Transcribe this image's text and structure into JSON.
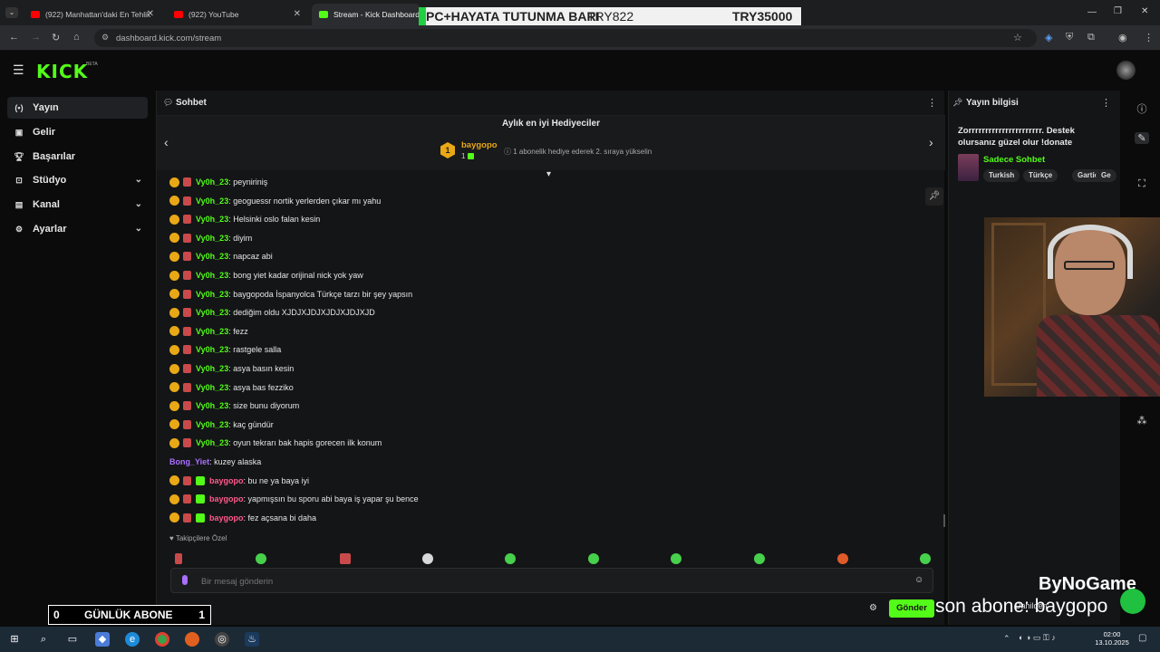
{
  "browser": {
    "tabs": [
      {
        "label": "(922) Manhattan'daki En Tehlik"
      },
      {
        "label": "(922) YouTube"
      },
      {
        "label": "Stream - Kick Dashboard"
      }
    ],
    "url": "dashboard.kick.com/stream"
  },
  "overlay_top": {
    "title": "PC+HAYATA TUTUNMA BARI",
    "current": "TRY822",
    "goal": "TRY35000"
  },
  "kick": {
    "logo": "KICK",
    "beta": "BETA"
  },
  "sidebar": {
    "items": [
      {
        "label": "Yayın"
      },
      {
        "label": "Gelir"
      },
      {
        "label": "Başarılar"
      },
      {
        "label": "Stüdyo"
      },
      {
        "label": "Kanal"
      },
      {
        "label": "Ayarlar"
      }
    ]
  },
  "chat": {
    "title": "Sohbet",
    "gifters_title": "Aylık en iyi Hediyeciler",
    "top_gifter": {
      "name": "baygopo",
      "rank": "1",
      "count": "1"
    },
    "gift_hint": "1 abonelik hediye ederek 2. sıraya yükselin",
    "messages": [
      {
        "user": "Vy0h_23",
        "text": ": peyniriniş"
      },
      {
        "user": "Vy0h_23",
        "text": ": geoguessr nortik yerlerden çıkar mı yahu"
      },
      {
        "user": "Vy0h_23",
        "text": ": Helsinki oslo falan kesin"
      },
      {
        "user": "Vy0h_23",
        "text": ": diyim"
      },
      {
        "user": "Vy0h_23",
        "text": ": napcaz abi"
      },
      {
        "user": "Vy0h_23",
        "text": ": bong yiet kadar orijinal nick yok yaw"
      },
      {
        "user": "Vy0h_23",
        "text": ": baygopoda İspanyolca Türkçe tarzı bir şey yapsın"
      },
      {
        "user": "Vy0h_23",
        "text": ": dediğim oldu XJDJXJDJXJDJXJDJXJD"
      },
      {
        "user": "Vy0h_23",
        "text": ": fezz"
      },
      {
        "user": "Vy0h_23",
        "text": ": rastgele salla"
      },
      {
        "user": "Vy0h_23",
        "text": ": asya basın kesin"
      },
      {
        "user": "Vy0h_23",
        "text": ": asya bas fezziko"
      },
      {
        "user": "Vy0h_23",
        "text": ": size bunu diyorum"
      },
      {
        "user": "Vy0h_23",
        "text": ": kaç gündür"
      },
      {
        "user": "Vy0h_23",
        "text": ": oyun tekrarı bak hapis gorecen ilk konum"
      },
      {
        "user": "Bong_Yiet",
        "text": ": kuzey alaska"
      },
      {
        "user": "baygopo",
        "text": ": bu ne ya baya iyi"
      },
      {
        "user": "baygopo",
        "text": ": yapmışsın bu sporu abi baya iş yapar şu bence"
      },
      {
        "user": "baygopo",
        "text": ": fez açsana bi daha"
      }
    ],
    "emotes_label": "Takipçilere Özel",
    "input_placeholder": "Bir mesaj gönderin",
    "send_label": "Gönder"
  },
  "stream_info": {
    "title": "Yayın bilgisi",
    "stream_title": "Zorrrrrrrrrrrrrrrrrrrrrr. Destek olursanız güzel olur !donate",
    "category": "Sadece Sohbet",
    "tags": [
      "Turkish",
      "Türkçe",
      "Gartic",
      "Ge"
    ]
  },
  "overlays": {
    "abone_left": "0",
    "abone_label": "GÜNLÜK ABONE",
    "abone_right": "1",
    "son_abone": "son abone: baygopo",
    "brand": "ByNoGame",
    "dahilden": "Dahilden"
  },
  "taskbar": {
    "time": "02:00",
    "date": "13.10.2025"
  },
  "colors": {
    "kick_green": "#53fc18",
    "username_green": "#53fc18",
    "username_purple": "#a970ff",
    "username_pink": "#ff5a8c",
    "badge_gold": "#e9a815"
  }
}
